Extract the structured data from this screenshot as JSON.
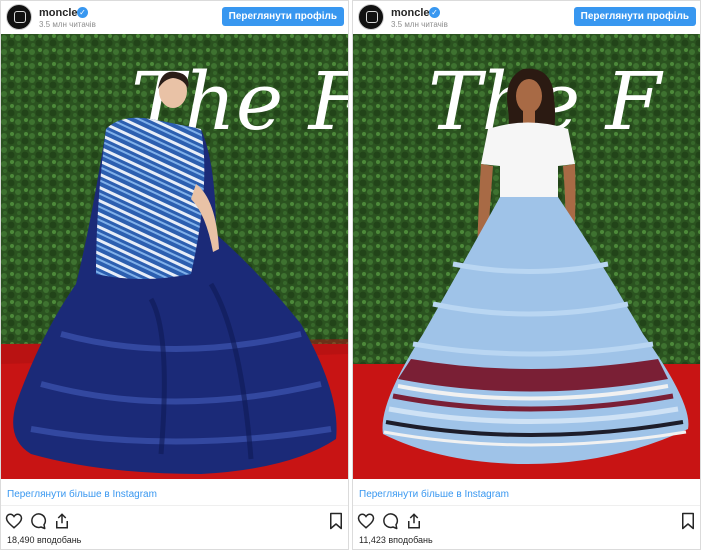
{
  "posts": [
    {
      "username": "moncler",
      "followers": "3.5 млн читачів",
      "profile_button": "Переглянути профіль",
      "more_link": "Переглянути більше в Instagram",
      "likes": "18,490 вподобань",
      "photo": {
        "backdrop_text": "The F",
        "gown_color": "#1f2f7a",
        "stripe_color": "#5b8ed8"
      }
    },
    {
      "username": "moncler",
      "followers": "3.5 млн читачів",
      "profile_button": "Переглянути профіль",
      "more_link": "Переглянути більше в Instagram",
      "likes": "11,423 вподобань",
      "photo": {
        "backdrop_text": "The F",
        "gown_color": "#9fc3e8",
        "stripe_color": "#7a1f35"
      }
    }
  ],
  "icons": [
    "heart-icon",
    "comment-icon",
    "share-icon",
    "bookmark-icon",
    "verified-icon"
  ],
  "colors": {
    "accent": "#3897f0",
    "carpet": "#d01818",
    "hedge": "#2f5a22"
  }
}
